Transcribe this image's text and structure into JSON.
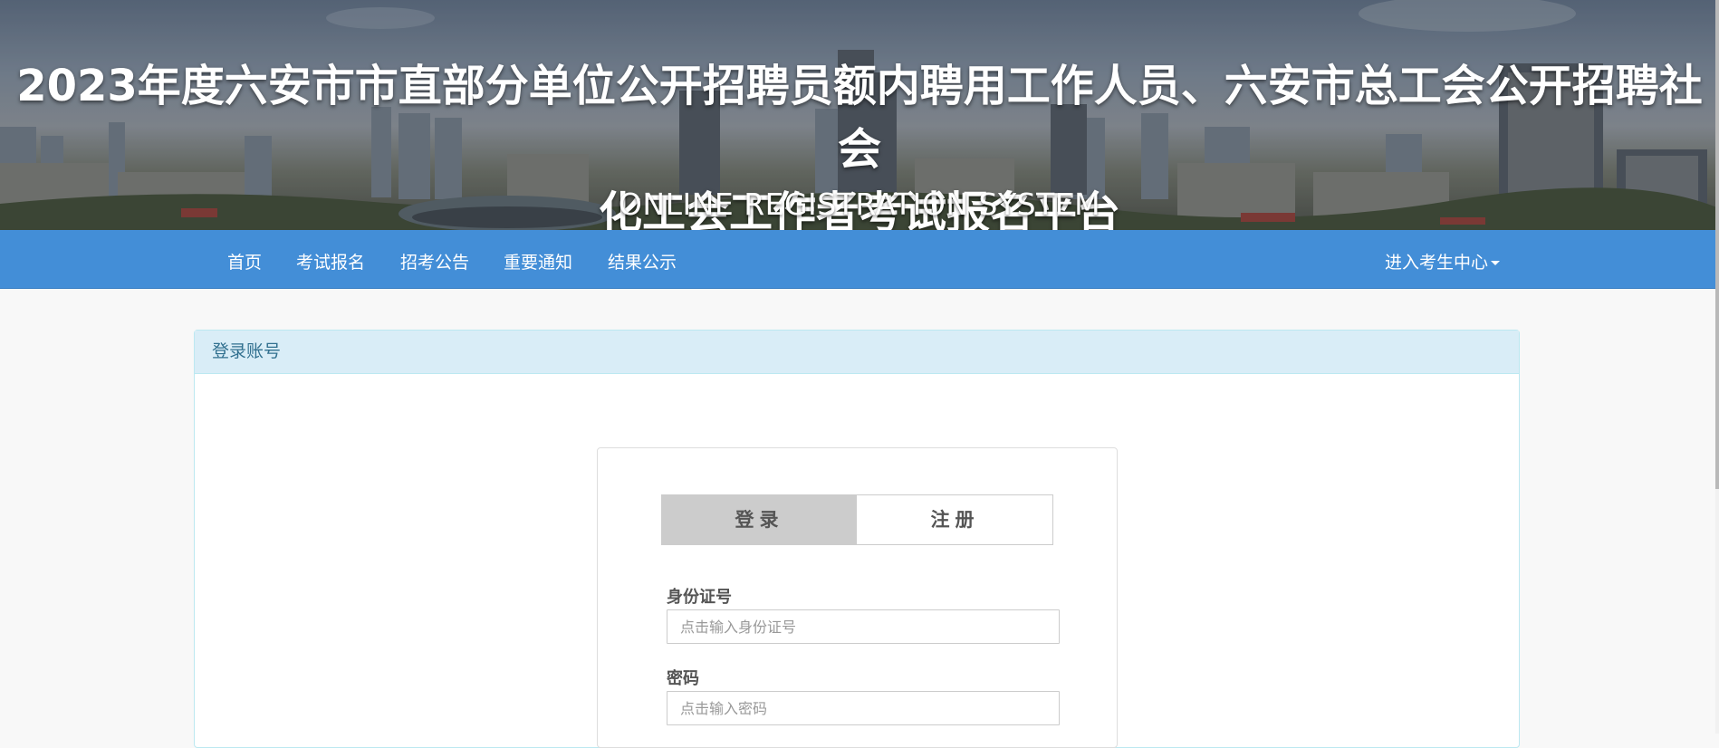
{
  "header": {
    "title_line1": "2023年度六安市市直部分单位公开招聘员额内聘用工作人员、六安市总工会公开招聘社会",
    "title_line2": "化工会工作者考试报名平台",
    "subtitle": "ONLINE REGISTRATION SYSTEM"
  },
  "nav": {
    "items": [
      {
        "label": "首页"
      },
      {
        "label": "考试报名"
      },
      {
        "label": "招考公告"
      },
      {
        "label": "重要通知"
      },
      {
        "label": "结果公示"
      }
    ],
    "user_menu": "进入考生中心"
  },
  "panel": {
    "heading": "登录账号"
  },
  "login": {
    "tab_login": "登录",
    "tab_register": "注册",
    "id_label": "身份证号",
    "id_placeholder": "点击输入身份证号",
    "pwd_label": "密码",
    "pwd_placeholder": "点击输入密码"
  },
  "colors": {
    "nav_bg": "#438ed7",
    "panel_heading_bg": "#d9edf7",
    "panel_heading_text": "#31708f",
    "active_tab_bg": "#cccccc"
  }
}
